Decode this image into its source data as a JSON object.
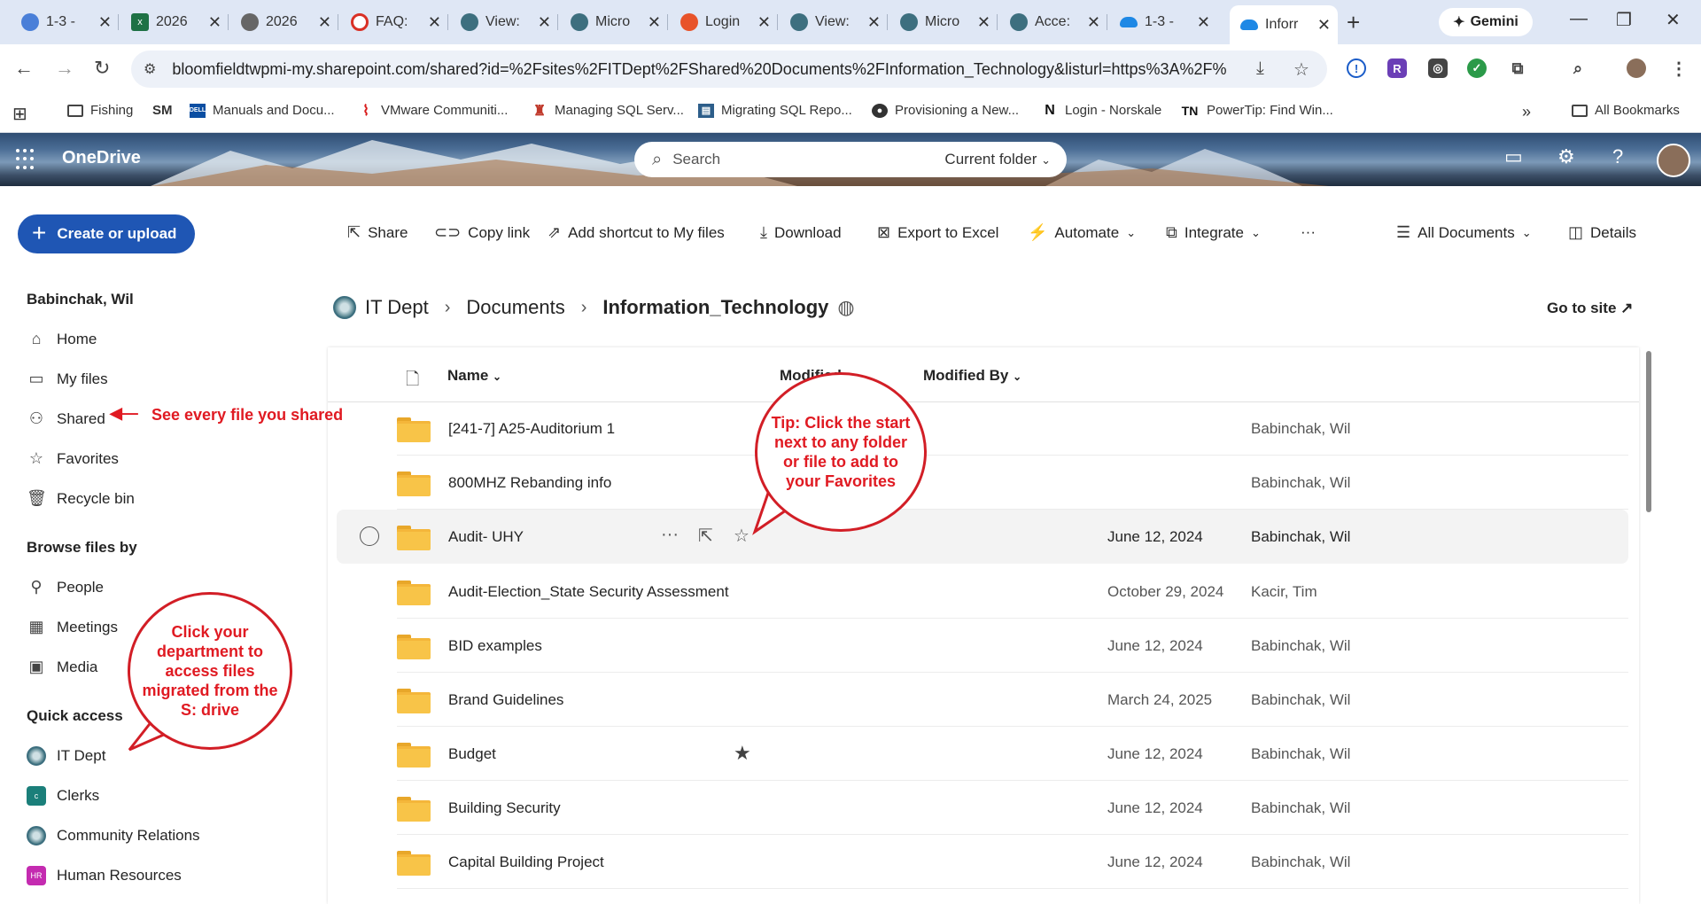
{
  "browser": {
    "tabs": [
      {
        "title": "1-3 -",
        "icon": "chrome-circle-icon",
        "color": "#4a7fd8"
      },
      {
        "title": "2026",
        "icon": "excel-icon",
        "color": "#1e7145"
      },
      {
        "title": "2026",
        "icon": "globe-icon",
        "color": "#555555"
      },
      {
        "title": "FAQ:",
        "icon": "red-ring-icon",
        "color": "#d93025"
      },
      {
        "title": "View:",
        "icon": "seal-icon",
        "color": "#3d6f7f"
      },
      {
        "title": "Micro",
        "icon": "seal-icon",
        "color": "#3d6f7f"
      },
      {
        "title": "Login",
        "icon": "login-icon",
        "color": "#e8532a"
      },
      {
        "title": "View:",
        "icon": "seal-icon",
        "color": "#3d6f7f"
      },
      {
        "title": "Micro",
        "icon": "seal-icon",
        "color": "#3d6f7f"
      },
      {
        "title": "Acce:",
        "icon": "seal-icon",
        "color": "#3d6f7f"
      },
      {
        "title": "1-3 -",
        "icon": "onedrive-icon",
        "color": "#1e88e5"
      },
      {
        "title": "Inforr",
        "icon": "onedrive-icon",
        "color": "#1e88e5"
      }
    ],
    "gemini_label": "Gemini",
    "url": "bloomfieldtwpmi-my.sharepoint.com/shared?id=%2Fsites%2FITDept%2FShared%20Documents%2FInformation_Technology&listurl=https%3A%2F%2Fblo...",
    "bookmarks": [
      {
        "label": "Fishing",
        "icon": "folder-icon"
      },
      {
        "label": "SM",
        "icon": ""
      },
      {
        "label": "Manuals and Docu...",
        "icon": "dell-icon"
      },
      {
        "label": "VMware Communiti...",
        "icon": "vmware-icon"
      },
      {
        "label": "Managing SQL Serv...",
        "icon": "sql-icon"
      },
      {
        "label": "Migrating SQL Repo...",
        "icon": "report-icon"
      },
      {
        "label": "Provisioning a New...",
        "icon": "github-icon"
      },
      {
        "label": "Login - Norskale",
        "icon": "norskale-icon"
      },
      {
        "label": "PowerTip: Find Win...",
        "icon": "tn-icon"
      }
    ],
    "all_bookmarks": "All Bookmarks"
  },
  "app": {
    "title": "OneDrive",
    "search_placeholder": "Search",
    "search_scope": "Current folder"
  },
  "nav": {
    "create_label": "Create or upload",
    "user_name": "Babinchak, Wil",
    "items": [
      {
        "label": "Home"
      },
      {
        "label": "My files"
      },
      {
        "label": "Shared"
      },
      {
        "label": "Favorites"
      },
      {
        "label": "Recycle bin"
      }
    ],
    "browse_heading": "Browse files by",
    "browse_items": [
      {
        "label": "People"
      },
      {
        "label": "Meetings"
      },
      {
        "label": "Media"
      }
    ],
    "quick_heading": "Quick access",
    "quick_items": [
      {
        "label": "IT Dept",
        "badge": ""
      },
      {
        "label": "Clerks",
        "badge": "c",
        "color": "#1b7f7a"
      },
      {
        "label": "Community Relations",
        "badge": ""
      },
      {
        "label": "Human Resources",
        "badge": "HR",
        "color": "#c42bb0"
      }
    ]
  },
  "toolbar": {
    "share": "Share",
    "copy_link": "Copy link",
    "add_shortcut": "Add shortcut to My files",
    "download": "Download",
    "export_excel": "Export to Excel",
    "automate": "Automate",
    "integrate": "Integrate",
    "more": "···",
    "view": "All Documents",
    "details": "Details"
  },
  "breadcrumb": {
    "site": "IT Dept",
    "library": "Documents",
    "current": "Information_Technology",
    "go_to_site": "Go to site"
  },
  "list": {
    "col_name": "Name",
    "col_modified": "Modified",
    "col_modified_by": "Modified By",
    "rows": [
      {
        "name": "[241-7] A25-Auditorium 1",
        "modified": "",
        "modified_by": "Babinchak, Wil"
      },
      {
        "name": "800MHZ Rebanding info",
        "modified": "",
        "modified_by": "Babinchak, Wil"
      },
      {
        "name": "Audit- UHY",
        "modified": "June 12, 2024",
        "modified_by": "Babinchak, Wil"
      },
      {
        "name": "Audit-Election_State Security Assessment",
        "modified": "October 29, 2024",
        "modified_by": "Kacir, Tim"
      },
      {
        "name": "BID examples",
        "modified": "June 12, 2024",
        "modified_by": "Babinchak, Wil"
      },
      {
        "name": "Brand Guidelines",
        "modified": "March 24, 2025",
        "modified_by": "Babinchak, Wil"
      },
      {
        "name": "Budget",
        "modified": "June 12, 2024",
        "modified_by": "Babinchak, Wil"
      },
      {
        "name": "Building Security",
        "modified": "June 12, 2024",
        "modified_by": "Babinchak, Wil"
      },
      {
        "name": "Capital Building Project",
        "modified": "June 12, 2024",
        "modified_by": "Babinchak, Wil"
      }
    ]
  },
  "annotations": {
    "shared_note": "See every file you shared",
    "dept_note": "Click your department to access files migrated from the S: drive",
    "tip_note": "Tip: Click the start next to any folder or file to add to your Favorites"
  }
}
